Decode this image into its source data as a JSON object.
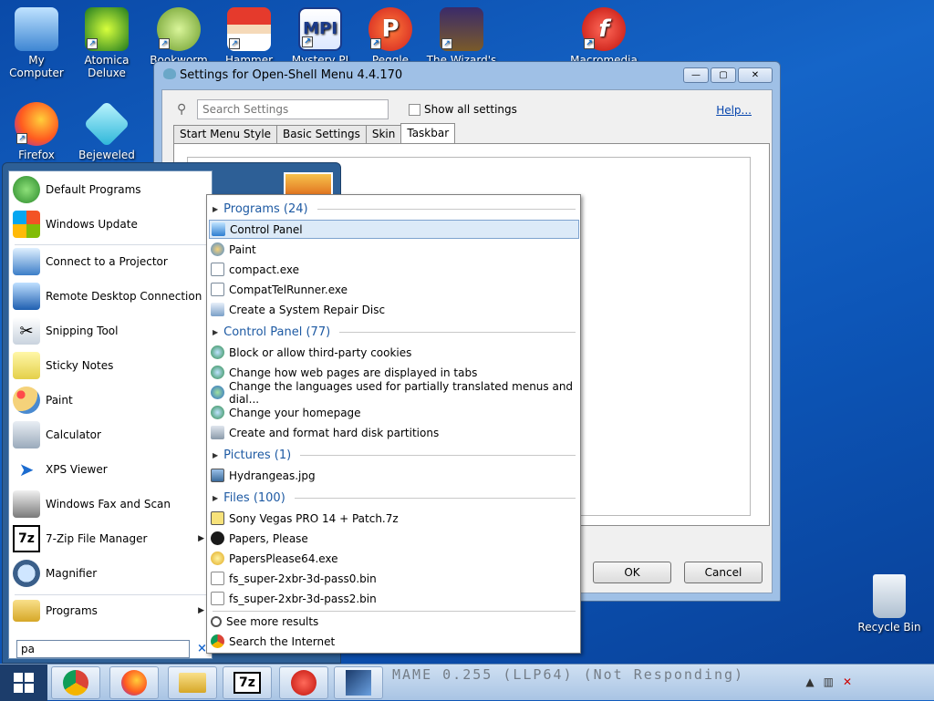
{
  "desktop": {
    "icons": [
      {
        "label": "My Computer"
      },
      {
        "label": "Atomica Deluxe"
      },
      {
        "label": "Bookworm"
      },
      {
        "label": "Hammer"
      },
      {
        "label": "Mystery PI"
      },
      {
        "label": "Peggle Nights"
      },
      {
        "label": "The Wizard's"
      },
      {
        "label": "Macromedia"
      },
      {
        "label": "Firefox"
      },
      {
        "label": "Bejeweled"
      },
      {
        "label": "Recycle Bin"
      }
    ]
  },
  "settings": {
    "title": "Settings for Open-Shell Menu 4.4.170",
    "search_placeholder": "Search Settings",
    "show_all": "Show all settings",
    "help": "Help...",
    "tabs": [
      "Start Menu Style",
      "Basic Settings",
      "Skin",
      "Taskbar"
    ],
    "ok": "OK",
    "cancel": "Cancel",
    "min": "—",
    "max": "▢",
    "close": "✕"
  },
  "start_menu": {
    "items": [
      {
        "label": "Default Programs"
      },
      {
        "label": "Windows Update"
      },
      {
        "label": "Connect to a Projector"
      },
      {
        "label": "Remote Desktop Connection"
      },
      {
        "label": "Snipping Tool"
      },
      {
        "label": "Sticky Notes"
      },
      {
        "label": "Paint"
      },
      {
        "label": "Calculator"
      },
      {
        "label": "XPS Viewer"
      },
      {
        "label": "Windows Fax and Scan"
      },
      {
        "label": "7-Zip File Manager"
      },
      {
        "label": "Magnifier"
      }
    ],
    "programs": "Programs",
    "search_value": "pa",
    "clear": "×"
  },
  "results": {
    "groups": [
      {
        "label": "Programs (24)",
        "items": [
          "Control Panel",
          "Paint",
          "compact.exe",
          "CompatTelRunner.exe",
          "Create a System Repair Disc"
        ]
      },
      {
        "label": "Control Panel (77)",
        "items": [
          "Block or allow third-party cookies",
          "Change how web pages are displayed in tabs",
          "Change the languages used for partially translated menus and dial...",
          "Change your homepage",
          "Create and format hard disk partitions"
        ]
      },
      {
        "label": "Pictures (1)",
        "items": [
          "Hydrangeas.jpg"
        ]
      },
      {
        "label": "Files (100)",
        "items": [
          "Sony Vegas PRO 14 + Patch.7z",
          "Papers, Please",
          "PapersPlease64.exe",
          "fs_super-2xbr-3d-pass0.bin",
          "fs_super-2xbr-3d-pass2.bin"
        ]
      }
    ],
    "see_more": "See more results",
    "search_internet": "Search the Internet"
  },
  "taskbar": {
    "ghost_text": "MAME 0.255 (LLP64) (Not Responding)",
    "zip_label": "7z"
  }
}
